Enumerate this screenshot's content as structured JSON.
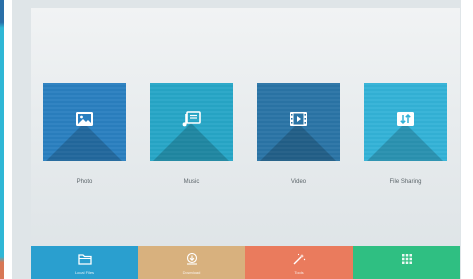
{
  "colors": {
    "photo": "#2a7fc0",
    "music": "#27a6c7",
    "video": "#2a74a6",
    "file_sharing": "#33b2d7",
    "dock_local": "#2a9fcf",
    "dock_download": "#d8b17e",
    "dock_tools": "#ea7b5d",
    "dock_apps": "#2fbf82"
  },
  "tiles": [
    {
      "label": "Photo",
      "icon": "image-icon"
    },
    {
      "label": "Music",
      "icon": "music-icon"
    },
    {
      "label": "Video",
      "icon": "video-icon"
    },
    {
      "label": "File Sharing",
      "icon": "file-sharing-icon"
    }
  ],
  "dock": [
    {
      "label": "Local Files",
      "icon": "folder-icon"
    },
    {
      "label": "Download",
      "icon": "download-icon"
    },
    {
      "label": "Tools",
      "icon": "magic-wand-icon"
    },
    {
      "label": "",
      "icon": "apps-grid-icon"
    }
  ]
}
